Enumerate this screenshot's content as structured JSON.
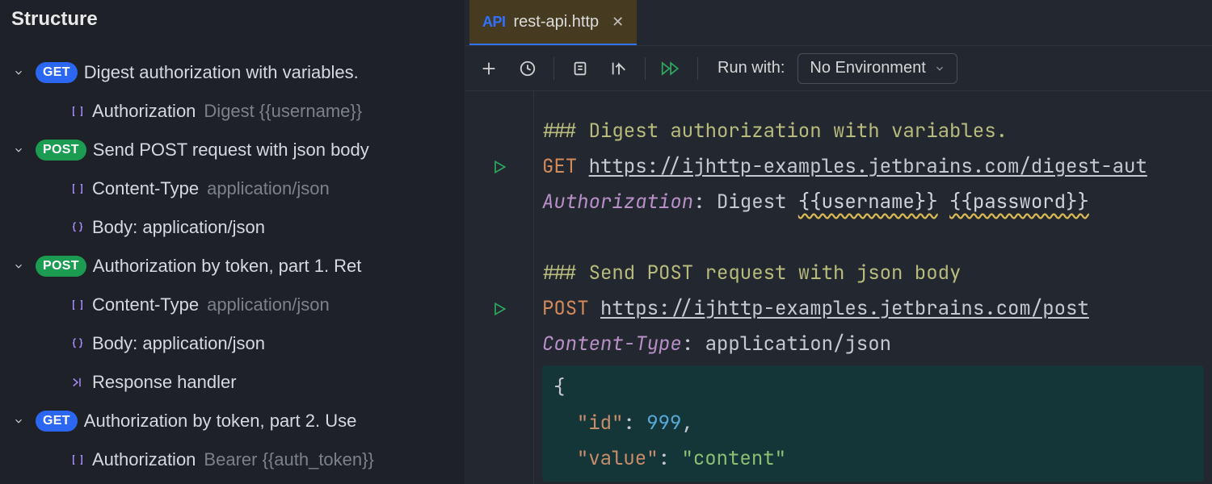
{
  "sidebar": {
    "title": "Structure",
    "items": [
      {
        "method": "GET",
        "label": "Digest authorization with variables."
      },
      {
        "header": "Authorization",
        "value": "Digest {{username}}"
      },
      {
        "method": "POST",
        "label": "Send POST request with json body"
      },
      {
        "header": "Content-Type",
        "value": "application/json"
      },
      {
        "body": "Body: application/json"
      },
      {
        "method": "POST",
        "label": "Authorization by token, part 1. Ret"
      },
      {
        "header": "Content-Type",
        "value": "application/json"
      },
      {
        "body": "Body: application/json"
      },
      {
        "resp": "Response handler"
      },
      {
        "method": "GET",
        "label": "Authorization by token, part 2. Use"
      },
      {
        "header": "Authorization",
        "value": "Bearer {{auth_token}}"
      }
    ]
  },
  "tab": {
    "icon": "API",
    "name": "rest-api.http"
  },
  "toolbar": {
    "run_with": "Run with:",
    "environment": "No Environment"
  },
  "code": {
    "r1_comment": "### Digest authorization with variables.",
    "r1_method": "GET",
    "r1_url": "https://ijhttp-examples.jetbrains.com/digest-aut",
    "r1_header": "Authorization",
    "r1_header_val": ": Digest ",
    "r1_var1": "{{username}}",
    "r1_var2": "{{password}}",
    "r2_comment": "### Send POST request with json body",
    "r2_method": "POST",
    "r2_url": "https://ijhttp-examples.jetbrains.com/post",
    "r2_header": "Content-Type",
    "r2_header_val": ": application/json",
    "body": {
      "open": "{",
      "id_key": "\"id\"",
      "id_val": "999",
      "comma": ",",
      "val_key": "\"value\"",
      "val_val": "\"content\"",
      "colon": ": "
    }
  }
}
